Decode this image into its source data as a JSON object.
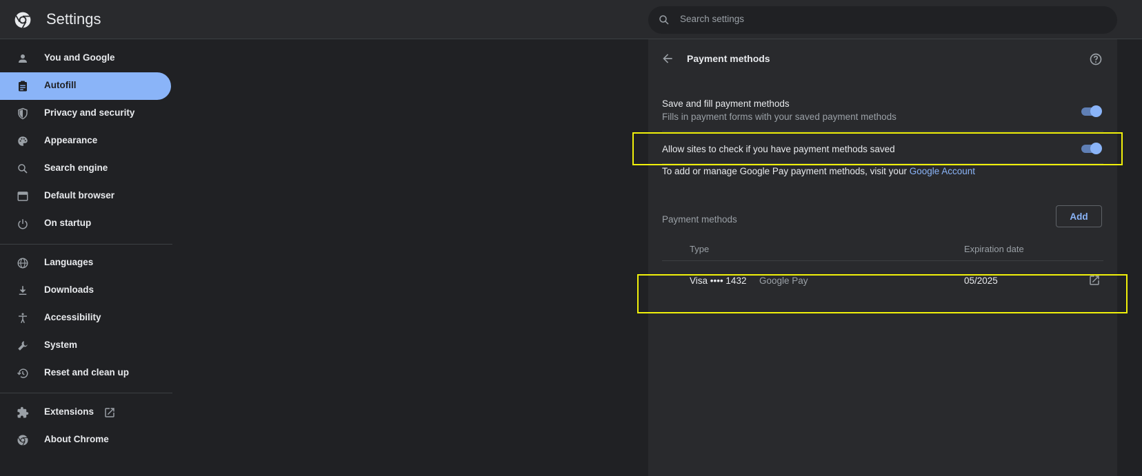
{
  "header": {
    "logo_icon": "chrome-icon",
    "title": "Settings",
    "search_placeholder": "Search settings",
    "search_icon": "search-icon"
  },
  "sidebar": {
    "items": [
      {
        "label": "You and Google",
        "icon": "person-icon"
      },
      {
        "label": "Autofill",
        "icon": "clipboard-icon",
        "active": true
      },
      {
        "label": "Privacy and security",
        "icon": "shield-icon"
      },
      {
        "label": "Appearance",
        "icon": "palette-icon"
      },
      {
        "label": "Search engine",
        "icon": "search-icon"
      },
      {
        "label": "Default browser",
        "icon": "browser-icon"
      },
      {
        "label": "On startup",
        "icon": "power-icon"
      },
      {
        "label": "Languages",
        "icon": "globe-icon"
      },
      {
        "label": "Downloads",
        "icon": "download-icon"
      },
      {
        "label": "Accessibility",
        "icon": "accessibility-icon"
      },
      {
        "label": "System",
        "icon": "wrench-icon"
      },
      {
        "label": "Reset and clean up",
        "icon": "restore-icon"
      },
      {
        "label": "Extensions",
        "icon": "puzzle-icon"
      },
      {
        "label": "About Chrome",
        "icon": "chrome-icon"
      }
    ]
  },
  "panel": {
    "title": "Payment methods",
    "save_fill": {
      "title": "Save and fill payment methods",
      "subtitle": "Fills in payment forms with your saved payment methods",
      "enabled": true
    },
    "allow_sites": {
      "title": "Allow sites to check if you have payment methods saved",
      "enabled": true
    },
    "google_pay_text": "To add or manage Google Pay payment methods, visit your",
    "google_pay_link": "Google Account",
    "section_label": "Payment methods",
    "add_label": "Add",
    "columns": {
      "type": "Type",
      "expiration": "Expiration date"
    },
    "cards": [
      {
        "name": "Visa •••• 1432",
        "source": "Google Pay",
        "expiration": "05/2025"
      }
    ]
  },
  "colors": {
    "accent": "#8ab4f8",
    "background": "#202124",
    "surface": "#292a2d",
    "highlight": "#f1f10a"
  }
}
